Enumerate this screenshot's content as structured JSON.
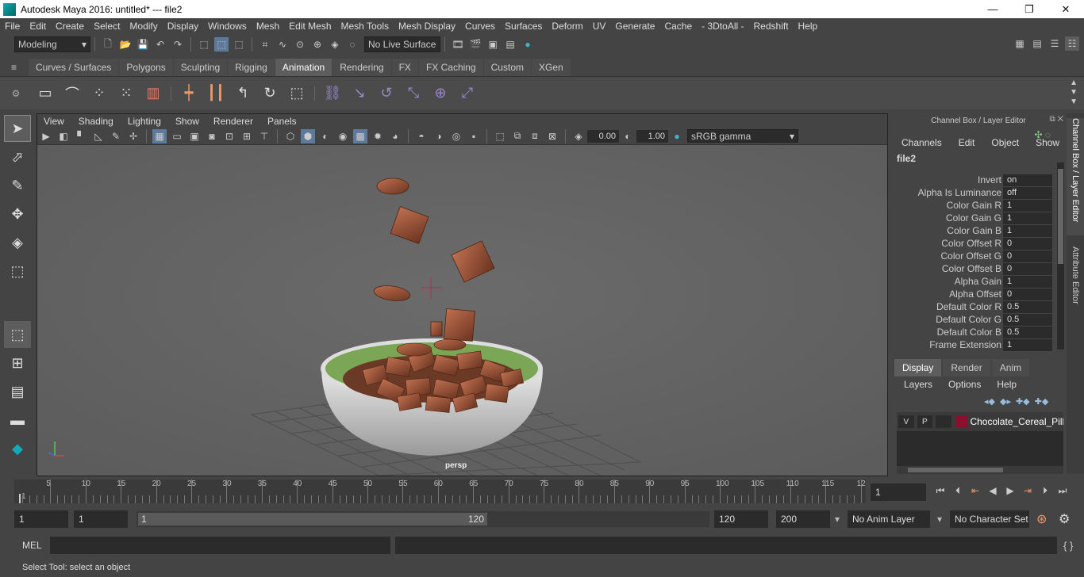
{
  "window": {
    "title": "Autodesk Maya 2016: untitled*   ---   file2",
    "minimize": "—",
    "restore": "❐",
    "close": "✕"
  },
  "menus": [
    "File",
    "Edit",
    "Create",
    "Select",
    "Modify",
    "Display",
    "Windows",
    "Mesh",
    "Edit Mesh",
    "Mesh Tools",
    "Mesh Display",
    "Curves",
    "Surfaces",
    "Deform",
    "UV",
    "Generate",
    "Cache",
    "- 3DtoAll -",
    "Redshift",
    "Help"
  ],
  "statusline": {
    "mode": "Modeling",
    "live_surface": "No Live Surface"
  },
  "shelf_tabs": [
    "Curves / Surfaces",
    "Polygons",
    "Sculpting",
    "Rigging",
    "Animation",
    "Rendering",
    "FX",
    "FX Caching",
    "Custom",
    "XGen"
  ],
  "active_shelf_tab": "Animation",
  "panel": {
    "menus": [
      "View",
      "Shading",
      "Lighting",
      "Show",
      "Renderer",
      "Panels"
    ],
    "exposure": "0.00",
    "gamma": "1.00",
    "color_space": "sRGB gamma",
    "camera_label": "persp"
  },
  "channel_box": {
    "title": "Channel Box / Layer Editor",
    "menus": [
      "Channels",
      "Edit",
      "Object",
      "Show"
    ],
    "node": "file2",
    "attributes": [
      {
        "label": "Invert",
        "value": "on"
      },
      {
        "label": "Alpha Is Luminance",
        "value": "off"
      },
      {
        "label": "Color Gain R",
        "value": "1"
      },
      {
        "label": "Color Gain G",
        "value": "1"
      },
      {
        "label": "Color Gain B",
        "value": "1"
      },
      {
        "label": "Color Offset R",
        "value": "0"
      },
      {
        "label": "Color Offset G",
        "value": "0"
      },
      {
        "label": "Color Offset B",
        "value": "0"
      },
      {
        "label": "Alpha Gain",
        "value": "1"
      },
      {
        "label": "Alpha Offset",
        "value": "0"
      },
      {
        "label": "Default Color R",
        "value": "0.5"
      },
      {
        "label": "Default Color G",
        "value": "0.5"
      },
      {
        "label": "Default Color B",
        "value": "0.5"
      },
      {
        "label": "Frame Extension",
        "value": "1"
      }
    ]
  },
  "side_tabs": {
    "channel_box": "Channel Box / Layer Editor",
    "attribute_editor": "Attribute Editor"
  },
  "layer_editor": {
    "tabs": [
      "Display",
      "Render",
      "Anim"
    ],
    "active_tab": "Display",
    "menus": [
      "Layers",
      "Options",
      "Help"
    ],
    "layers": [
      {
        "v": "V",
        "p": "P",
        "name": "Chocolate_Cereal_Pillo",
        "color": "#8b1030"
      }
    ]
  },
  "timeline": {
    "ticks": [
      "1",
      "5",
      "10",
      "15",
      "20",
      "25",
      "30",
      "35",
      "40",
      "45",
      "50",
      "55",
      "60",
      "65",
      "70",
      "75",
      "80",
      "85",
      "90",
      "95",
      "100",
      "105",
      "110",
      "115",
      "12"
    ],
    "current_frame": "1"
  },
  "range": {
    "start": "1",
    "playback_start": "1",
    "slider_start": "1",
    "slider_end": "120",
    "playback_end": "120",
    "end": "200",
    "anim_layer": "No Anim Layer",
    "char_set": "No Character Set"
  },
  "cmdline": {
    "label": "MEL"
  },
  "helpline": "Select Tool: select an object"
}
